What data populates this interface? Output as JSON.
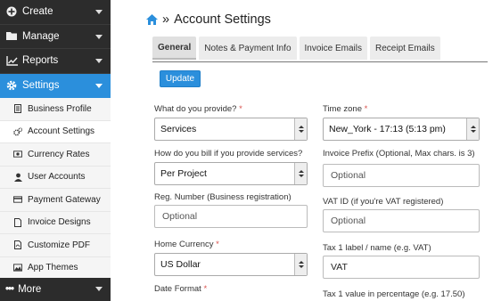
{
  "sidebar": {
    "main_items": [
      {
        "label": "Create",
        "icon": "plus-circle-icon"
      },
      {
        "label": "Manage",
        "icon": "folder-icon"
      },
      {
        "label": "Reports",
        "icon": "line-chart-icon"
      },
      {
        "label": "Settings",
        "icon": "gear-icon"
      }
    ],
    "sub_items": [
      {
        "label": "Business Profile",
        "icon": "document-icon"
      },
      {
        "label": "Account Settings",
        "icon": "cogs-icon"
      },
      {
        "label": "Currency Rates",
        "icon": "money-icon"
      },
      {
        "label": "User Accounts",
        "icon": "user-icon"
      },
      {
        "label": "Payment Gateway",
        "icon": "credit-card-icon"
      },
      {
        "label": "Invoice Designs",
        "icon": "file-icon"
      },
      {
        "label": "Customize PDF",
        "icon": "pdf-icon"
      },
      {
        "label": "App Themes",
        "icon": "image-icon"
      }
    ],
    "more_label": "More",
    "active_color": "#2b8fdc"
  },
  "header": {
    "title": "Account Settings",
    "separator": "»"
  },
  "tabs": [
    "General",
    "Notes & Payment Info",
    "Invoice Emails",
    "Receipt Emails"
  ],
  "update_label": "Update",
  "form": {
    "what_provide": {
      "label": "What do you provide?",
      "value": "Services"
    },
    "time_zone": {
      "label": "Time zone",
      "value": "New_York - 17:13 (5:13 pm)"
    },
    "bill_services": {
      "label": "How do you bill if you provide services?",
      "value": "Per Project"
    },
    "invoice_prefix": {
      "label": "Invoice Prefix (Optional, Max chars. is 3)",
      "placeholder": "Optional"
    },
    "reg_number": {
      "label": "Reg. Number (Business registration)",
      "placeholder": "Optional"
    },
    "vat_id": {
      "label": "VAT ID (if you're VAT registered)",
      "placeholder": "Optional"
    },
    "home_currency": {
      "label": "Home Currency",
      "value": "US Dollar"
    },
    "tax1_label": {
      "label": "Tax 1 label / name (e.g. VAT)",
      "value": "VAT"
    },
    "date_format": {
      "label": "Date Format"
    },
    "tax1_value": {
      "label": "Tax 1 value in percentage (e.g. 17.50)"
    },
    "required_mark": "*"
  }
}
